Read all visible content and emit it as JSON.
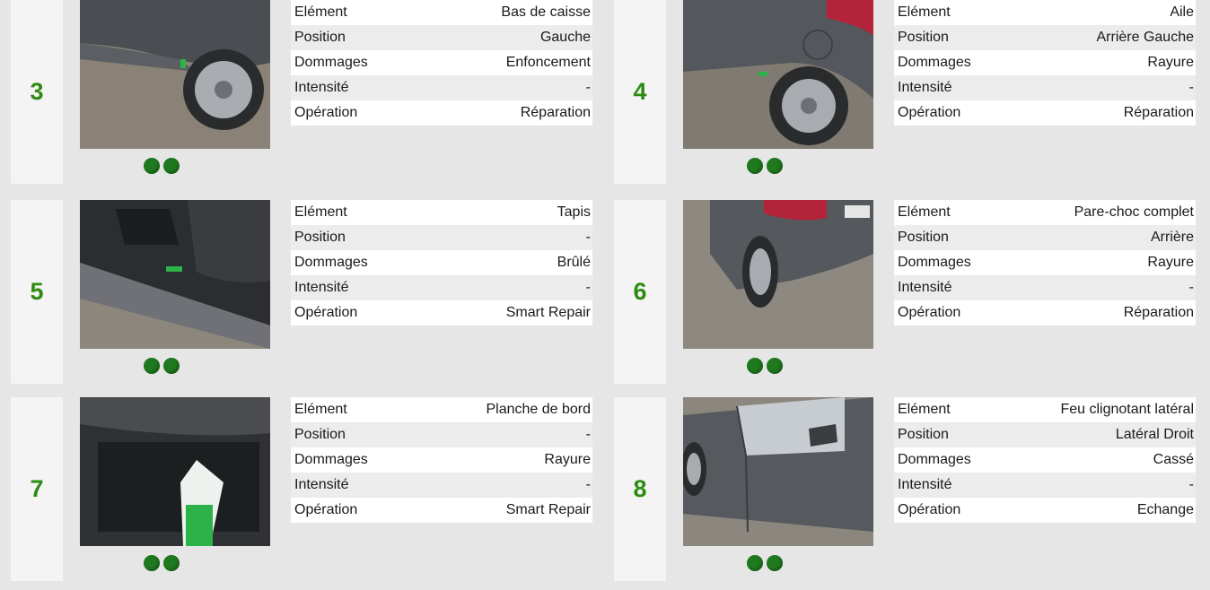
{
  "labels": {
    "element": "Elément",
    "position": "Position",
    "damage": "Dommages",
    "intensity": "Intensité",
    "operation": "Opération"
  },
  "colors": {
    "number": "#2e8b12",
    "dot": "#1f7a1f"
  },
  "cards": [
    {
      "number": "3",
      "element": "Bas de caisse",
      "position": "Gauche",
      "damage": "Enfoncement",
      "intensity": "-",
      "operation": "Réparation"
    },
    {
      "number": "4",
      "element": "Aile",
      "position": "Arrière Gauche",
      "damage": "Rayure",
      "intensity": "-",
      "operation": "Réparation"
    },
    {
      "number": "5",
      "element": "Tapis",
      "position": "-",
      "damage": "Brûlé",
      "intensity": "-",
      "operation": "Smart Repair"
    },
    {
      "number": "6",
      "element": "Pare-choc complet",
      "position": "Arrière",
      "damage": "Rayure",
      "intensity": "-",
      "operation": "Réparation"
    },
    {
      "number": "7",
      "element": "Planche de bord",
      "position": "-",
      "damage": "Rayure",
      "intensity": "-",
      "operation": "Smart Repair"
    },
    {
      "number": "8",
      "element": "Feu clignotant latéral",
      "position": "Latéral Droit",
      "damage": "Cassé",
      "intensity": "-",
      "operation": "Echange"
    }
  ]
}
